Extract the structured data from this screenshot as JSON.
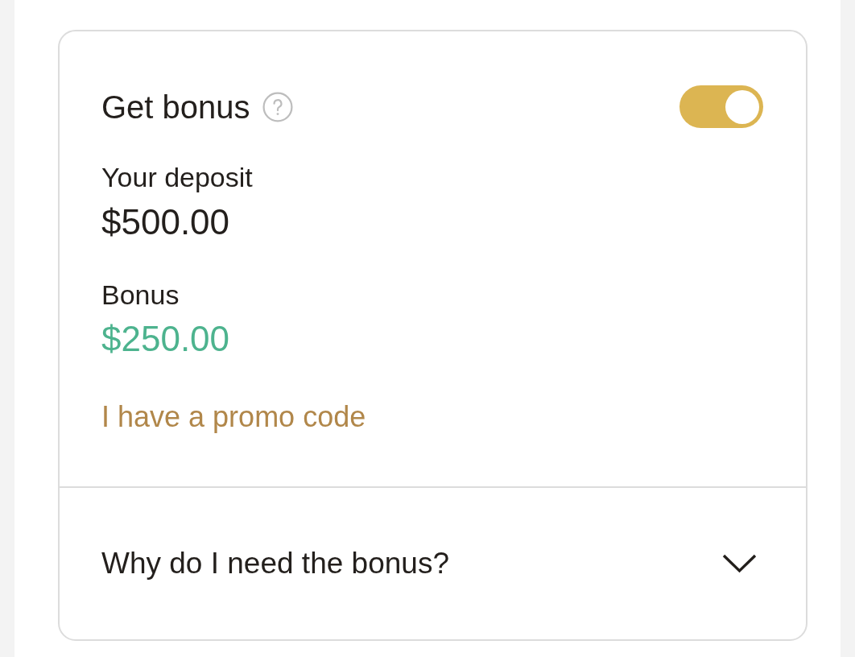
{
  "bonus_card": {
    "title": "Get bonus",
    "bonus_toggle": {
      "on": true
    },
    "deposit": {
      "label": "Your deposit",
      "value": "$500.00"
    },
    "bonus": {
      "label": "Bonus",
      "value": "$250.00"
    },
    "promo_link": "I have a promo code"
  },
  "faq": {
    "question": "Why do I need the bonus?",
    "expanded": false
  }
}
